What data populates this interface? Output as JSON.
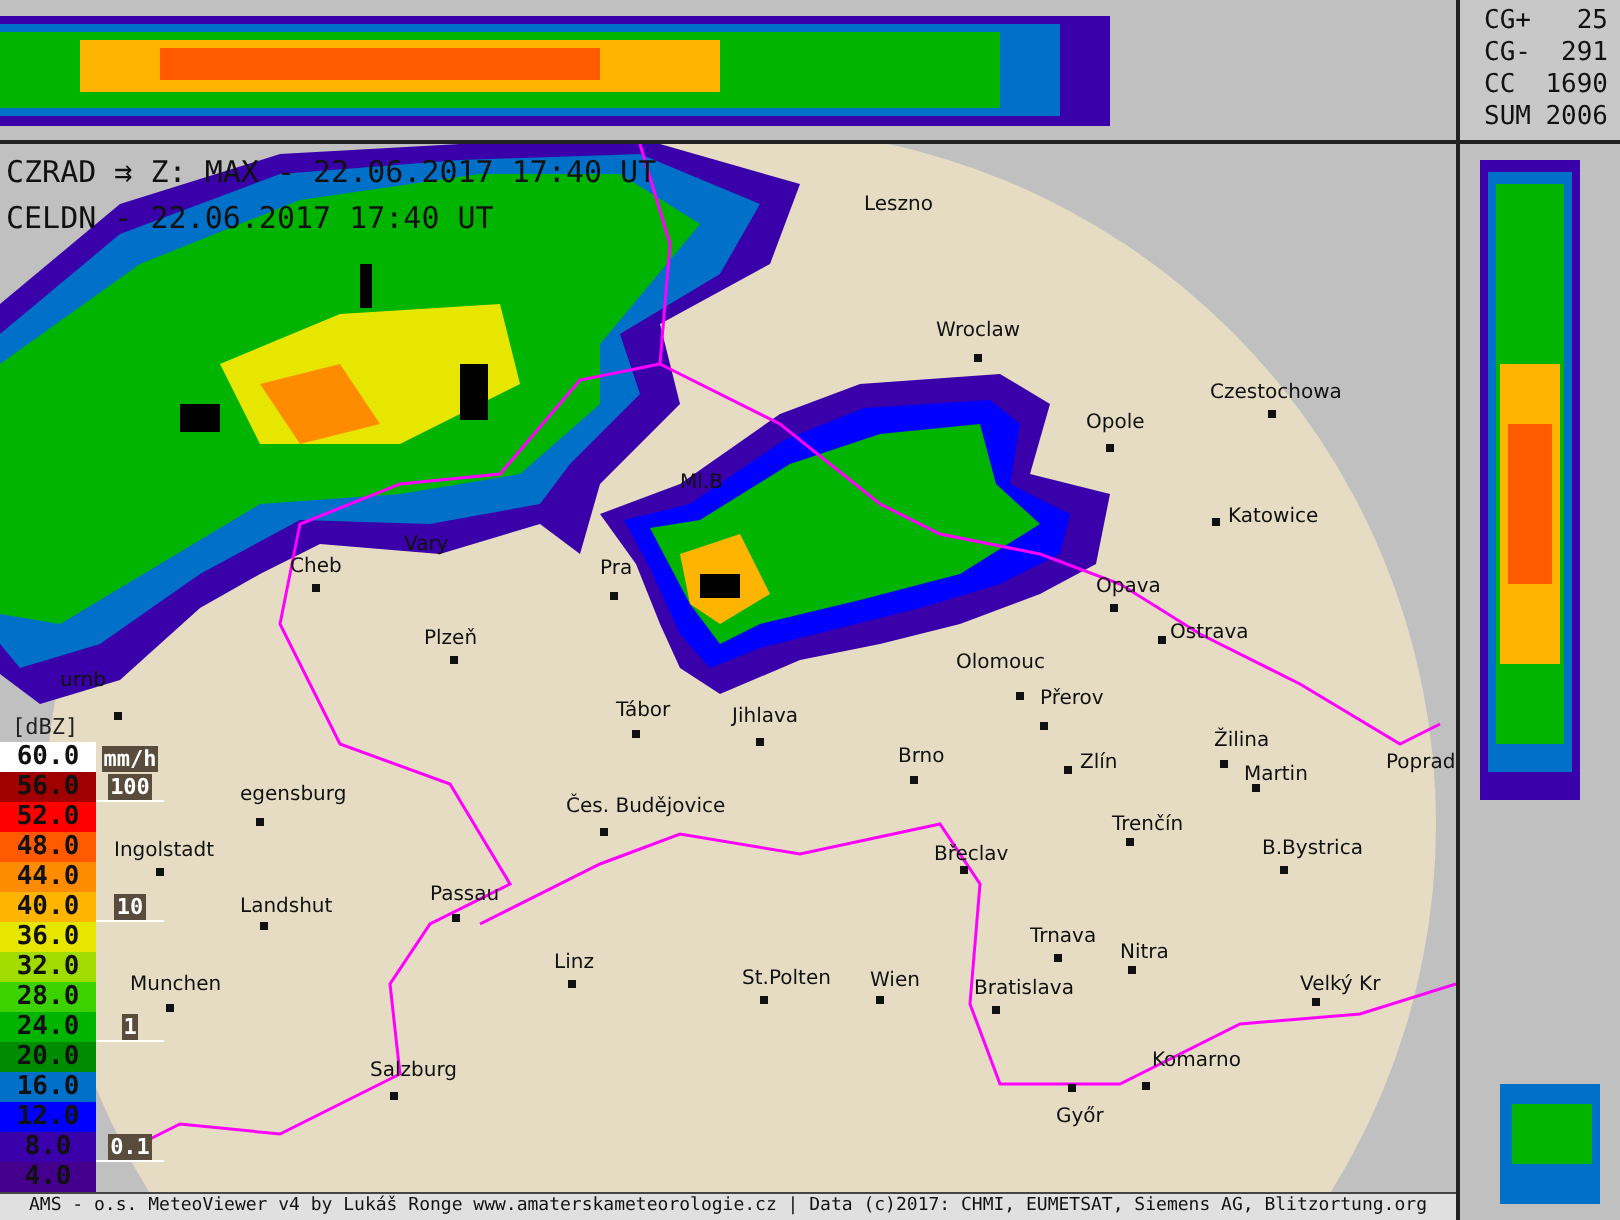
{
  "header": {
    "lines": [
      "CZRAD ⇉ Z: MAX - 22.06.2017 17:40 UT",
      "CELDN - 22.06.2017 17:40 UT"
    ]
  },
  "lightning_stats": [
    {
      "label": "CG+",
      "value": "25"
    },
    {
      "label": "CG-",
      "value": "291"
    },
    {
      "label": "CC",
      "value": "1690"
    },
    {
      "label": "SUM",
      "value": "2006"
    }
  ],
  "legend": {
    "unit": "[dBZ]",
    "rain_unit": "mm/h",
    "rain_marks": [
      "100",
      "10",
      "1",
      "0.1"
    ],
    "levels": [
      {
        "value": "60.0",
        "color": "#ffffff"
      },
      {
        "value": "56.0",
        "color": "#a00000"
      },
      {
        "value": "52.0",
        "color": "#ff0000"
      },
      {
        "value": "48.0",
        "color": "#ff5a00"
      },
      {
        "value": "44.0",
        "color": "#ff8c00"
      },
      {
        "value": "40.0",
        "color": "#ffb400"
      },
      {
        "value": "36.0",
        "color": "#e6e600"
      },
      {
        "value": "32.0",
        "color": "#a0dc00"
      },
      {
        "value": "28.0",
        "color": "#3cd200"
      },
      {
        "value": "24.0",
        "color": "#00b400"
      },
      {
        "value": "20.0",
        "color": "#008c00"
      },
      {
        "value": "16.0",
        "color": "#0070c8"
      },
      {
        "value": "12.0",
        "color": "#0000ff"
      },
      {
        "value": "8.0",
        "color": "#3a00aa"
      },
      {
        "value": "4.0",
        "color": "#44008c"
      }
    ]
  },
  "map": {
    "cities": [
      {
        "name": "Leszno"
      },
      {
        "name": "Wroclaw"
      },
      {
        "name": "Opole"
      },
      {
        "name": "Czestochowa"
      },
      {
        "name": "Katowice"
      },
      {
        "name": "Opava"
      },
      {
        "name": "Ostrava"
      },
      {
        "name": "Olomouc"
      },
      {
        "name": "Přerov"
      },
      {
        "name": "Pra"
      },
      {
        "name": "Vary"
      },
      {
        "name": "Cheb"
      },
      {
        "name": "Ml.B"
      },
      {
        "name": "Plzeň"
      },
      {
        "name": "Tábor"
      },
      {
        "name": "Jihlava"
      },
      {
        "name": "urnb"
      },
      {
        "name": "egensburg"
      },
      {
        "name": "Ingolstadt"
      },
      {
        "name": "Landshut"
      },
      {
        "name": "Munchen"
      },
      {
        "name": "Salzburg"
      },
      {
        "name": "Passau"
      },
      {
        "name": "Linz"
      },
      {
        "name": "Čes. Budějovice"
      },
      {
        "name": "Brno"
      },
      {
        "name": "Zlín"
      },
      {
        "name": "Břeclav"
      },
      {
        "name": "St.Polten"
      },
      {
        "name": "Wien"
      },
      {
        "name": "Trenčín"
      },
      {
        "name": "Trnava"
      },
      {
        "name": "Bratislava"
      },
      {
        "name": "Nitra"
      },
      {
        "name": "Žilina"
      },
      {
        "name": "Martin"
      },
      {
        "name": "B.Bystrica"
      },
      {
        "name": "Poprad"
      },
      {
        "name": "Velký Kr"
      },
      {
        "name": "Komarno"
      },
      {
        "name": "Győr"
      }
    ]
  },
  "footer": "AMS - o.s. MeteoViewer v4 by Lukáš Ronge www.amaterskameteorologie.cz | Data (c)2017: CHMI, EUMETSAT, Siemens AG, Blitzortung.org"
}
